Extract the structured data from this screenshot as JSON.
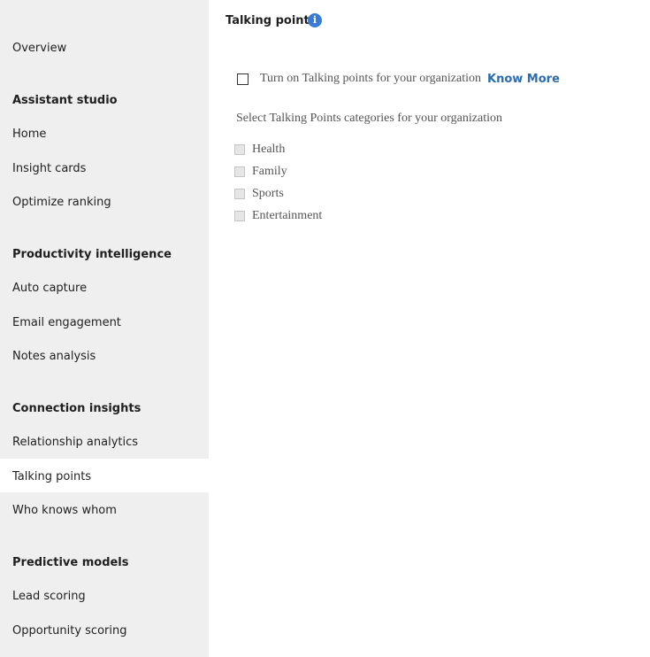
{
  "sidebar": {
    "items": [
      {
        "label": "Overview",
        "type": "item"
      },
      {
        "label": "Assistant studio",
        "type": "heading"
      },
      {
        "label": "Home",
        "type": "item"
      },
      {
        "label": "Insight cards",
        "type": "item"
      },
      {
        "label": "Optimize ranking",
        "type": "item"
      },
      {
        "label": "Productivity intelligence",
        "type": "heading"
      },
      {
        "label": "Auto capture",
        "type": "item"
      },
      {
        "label": "Email engagement",
        "type": "item"
      },
      {
        "label": "Notes analysis",
        "type": "item"
      },
      {
        "label": "Connection insights",
        "type": "heading"
      },
      {
        "label": "Relationship analytics",
        "type": "item"
      },
      {
        "label": "Talking points",
        "type": "item",
        "selected": true
      },
      {
        "label": "Who knows whom",
        "type": "item"
      },
      {
        "label": "Predictive models",
        "type": "heading"
      },
      {
        "label": "Lead scoring",
        "type": "item"
      },
      {
        "label": "Opportunity scoring",
        "type": "item"
      }
    ]
  },
  "page": {
    "title": "Talking points",
    "info_icon": "info-icon",
    "enable": {
      "label": "Turn on Talking points for your organization",
      "checked": false
    },
    "know_more": "Know More",
    "categories_label": "Select Talking Points categories for your organization",
    "categories": [
      {
        "label": "Health",
        "checked": false,
        "disabled": true
      },
      {
        "label": "Family",
        "checked": false,
        "disabled": true
      },
      {
        "label": "Sports",
        "checked": false,
        "disabled": true
      },
      {
        "label": "Entertainment",
        "checked": false,
        "disabled": true
      }
    ]
  },
  "colors": {
    "sidebar_bg": "#efefef",
    "selected_bg": "#ffffff",
    "link": "#2b6cb0",
    "info_icon": "#3a7bd5"
  }
}
